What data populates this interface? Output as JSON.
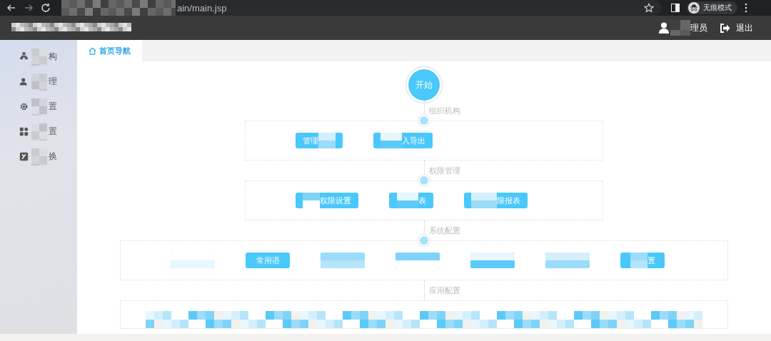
{
  "browser": {
    "url": "ain/main.jsp",
    "incognito_label": "无痕模式"
  },
  "header": {
    "user": "理员",
    "logout": "退出"
  },
  "sidebar": {
    "items": [
      {
        "label": "构"
      },
      {
        "label": "理"
      },
      {
        "label": "置"
      },
      {
        "label": "置"
      },
      {
        "label": "换"
      }
    ]
  },
  "tabs": [
    {
      "label": "首页导航",
      "selected": true
    }
  ],
  "flow": {
    "start": "开始",
    "sections": [
      {
        "title": "组织机构",
        "buttons": [
          {
            "text": "管理",
            "kind": "end"
          },
          {
            "text": "入导出",
            "kind": "start"
          }
        ]
      },
      {
        "title": "权限管理",
        "buttons": [
          {
            "text": "权限设置",
            "kind": "start"
          },
          {
            "text": "表",
            "kind": "start"
          },
          {
            "text": "限报表",
            "kind": "start"
          }
        ]
      },
      {
        "title": "系统配置",
        "buttons": [
          {
            "kind": "full"
          },
          {
            "text": "常用语",
            "kind": "plain"
          },
          {
            "kind": "full"
          },
          {
            "kind": "full"
          },
          {
            "kind": "full"
          },
          {
            "kind": "full"
          },
          {
            "text": "置",
            "kind": "start"
          }
        ]
      },
      {
        "title": "应用配置"
      }
    ]
  }
}
